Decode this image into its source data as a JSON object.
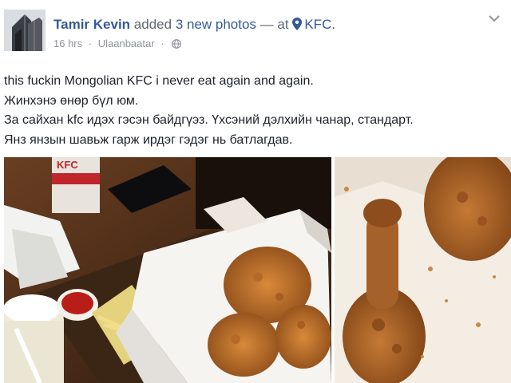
{
  "post": {
    "author": "Tamir Kevin",
    "action": "added",
    "photo_count_text": "3 new photos",
    "dash": "—",
    "at_text": "at",
    "place": "KFC.",
    "time": "16 hrs",
    "meta_separator": "·",
    "location": "Ulaanbaatar",
    "text_lines": [
      "this fuckin Mongolian KFC i never eat again and again.",
      "Жинхэнэ өнөр бүл юм.",
      "За сайхан kfc идэх гэсэн байдгүэз. Үхсэний дэлхийн чанар, стандарт.",
      "Янз янзын шавьж гарж ирдэг гэдэг нь батлагдав."
    ]
  },
  "photos": {
    "left": {
      "cup_logo_text": "KFC"
    },
    "right": {}
  },
  "icons": {
    "avatar": "avatar-building-photo",
    "place": "location-pin-icon",
    "privacy": "globe-icon",
    "options": "chevron-down-icon"
  },
  "colors": {
    "link": "#365899",
    "meta": "#90949c",
    "text": "#1d2129"
  }
}
